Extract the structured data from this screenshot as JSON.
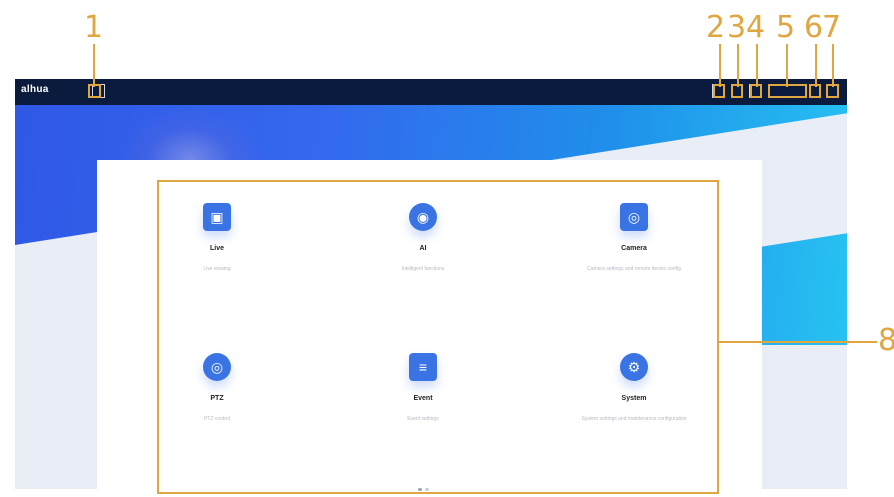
{
  "callouts": [
    "1",
    "2",
    "3",
    "4",
    "5",
    "6",
    "7",
    "8"
  ],
  "header": {
    "logo": "alhua"
  },
  "modules": [
    {
      "title": "Live",
      "desc": "Live viewing",
      "icon": "monitor-icon"
    },
    {
      "title": "AI",
      "desc": "Intelligent functions",
      "icon": "ai-icon"
    },
    {
      "title": "Camera",
      "desc": "Camera settings and remote device config",
      "icon": "camera-icon"
    },
    {
      "title": "PTZ",
      "desc": "PTZ control",
      "icon": "ptz-icon"
    },
    {
      "title": "Event",
      "desc": "Event settings",
      "icon": "event-icon"
    },
    {
      "title": "System",
      "desc": "System settings and maintenance configuration",
      "icon": "system-icon"
    }
  ],
  "colors": {
    "callout": "#e0a640",
    "topbar": "#0b1b3d",
    "icon": "#3a73e4",
    "banner_start": "#2f58e6",
    "banner_end": "#27c2f2"
  }
}
